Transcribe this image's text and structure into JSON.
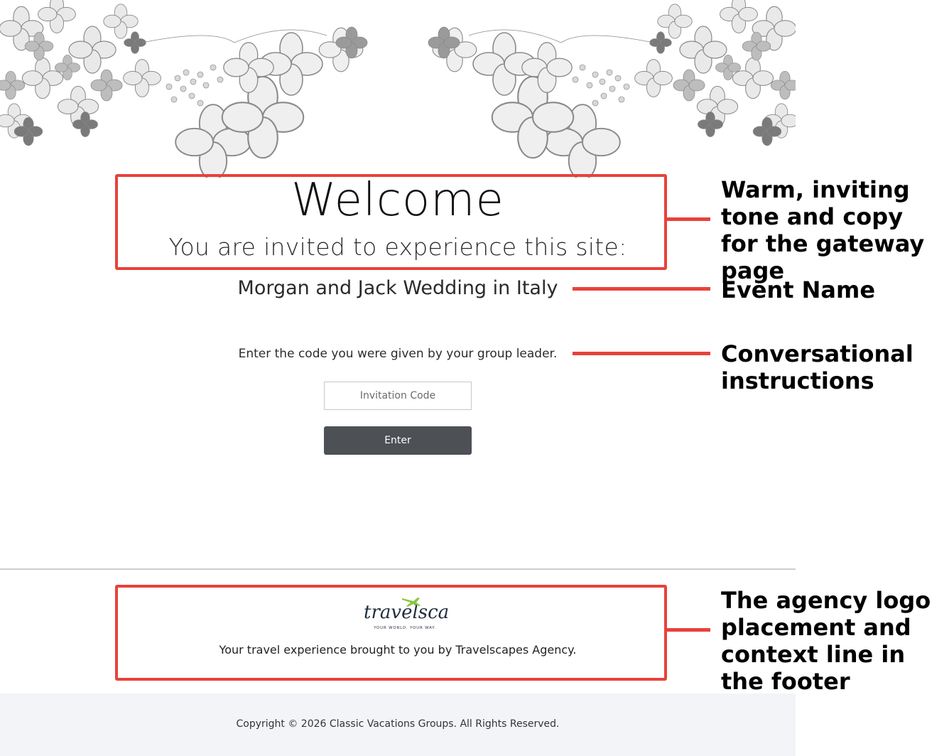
{
  "welcome": {
    "title": "Welcome",
    "subtitle": "You are invited to experience this site:"
  },
  "event": {
    "name": "Morgan and Jack Wedding in Italy"
  },
  "form": {
    "instructions": "Enter the code you were given by your group leader.",
    "code_placeholder": "Invitation Code",
    "code_value": "",
    "enter_label": "Enter"
  },
  "footer": {
    "logo_text": "travelscapes",
    "logo_tagline": "YOUR WORLD. YOUR WAY.",
    "agency_line": "Your travel experience brought to you by Travelscapes Agency.",
    "copyright": "Copyright © 2026 Classic Vacations Groups. All Rights Reserved."
  },
  "annotations": {
    "tone": "Warm, inviting tone and copy for the gateway page",
    "event_name": "Event Name",
    "instructions": "Conversational instructions",
    "agency": "The agency logo placement and context line in the footer"
  },
  "colors": {
    "annotation_red": "#e8423a",
    "button_bg": "#4d5054",
    "footer_bg": "#f2f4f8",
    "logo_green": "#8cc63f",
    "logo_navy": "#1f2d3d"
  }
}
